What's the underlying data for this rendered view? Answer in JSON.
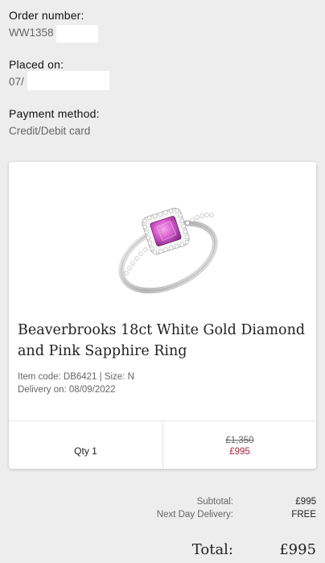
{
  "order": {
    "number_label": "Order number:",
    "number_value": "WW1358",
    "placed_label": "Placed on:",
    "placed_value": "07/",
    "payment_label": "Payment method:",
    "payment_value": "Credit/Debit card"
  },
  "product": {
    "title": "Beaverbrooks 18ct White Gold Diamond and Pink Sapphire Ring",
    "item_code": "Item code: DB6421 | Size: N",
    "delivery": "Delivery on: 08/09/2022",
    "image_icon": "ring-image",
    "qty_label": "Qty 1",
    "price_old": "£1,350",
    "price_new": "£995",
    "accent_color": "#b0203a"
  },
  "summary": {
    "subtotal_label": "Subtotal:",
    "subtotal_value": "£995",
    "delivery_label": "Next Day Delivery:",
    "delivery_value": "FREE",
    "total_label": "Total:",
    "total_value": "£995"
  }
}
